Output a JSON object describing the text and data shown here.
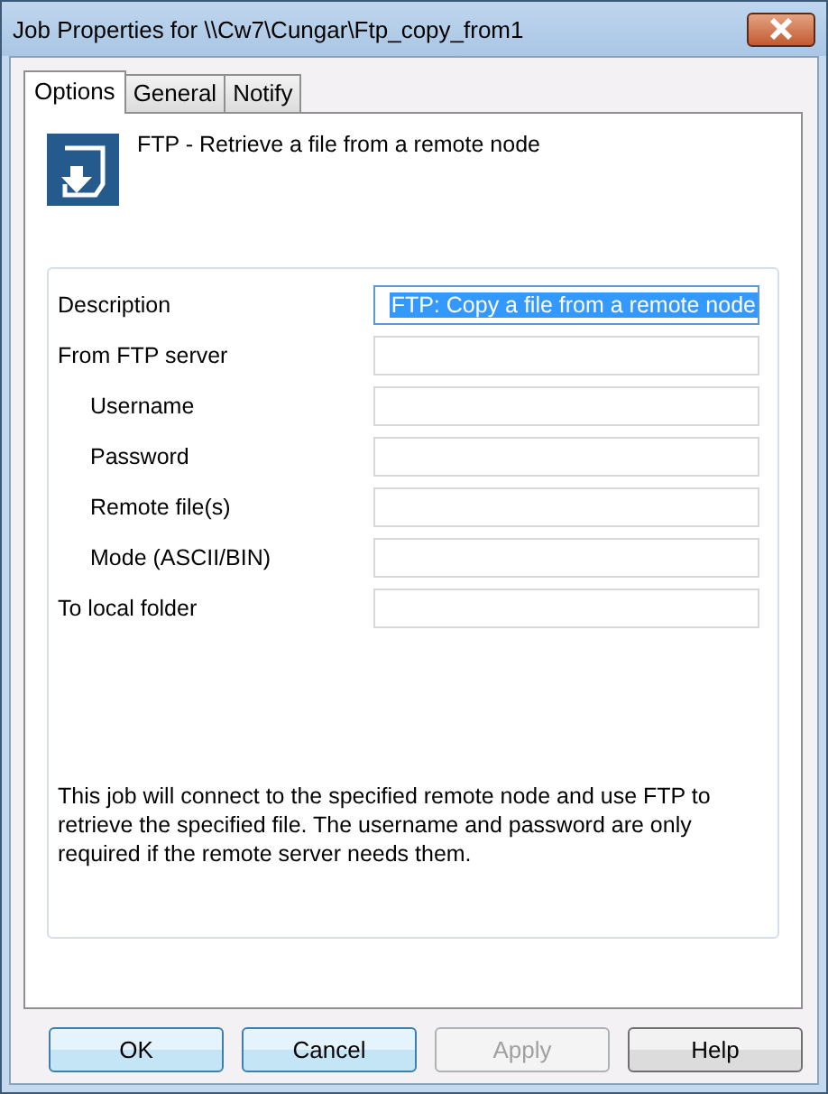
{
  "window": {
    "title": "Job Properties for \\\\Cw7\\Cungar\\Ftp_copy_from1"
  },
  "tabs": [
    {
      "label": "Options",
      "selected": true
    },
    {
      "label": "General",
      "selected": false
    },
    {
      "label": "Notify",
      "selected": false
    }
  ],
  "header": "FTP - Retrieve a file from a remote node",
  "fields": [
    {
      "label": "Description",
      "value": "FTP: Copy a file from a remote node",
      "text_selected": true
    },
    {
      "label": "From FTP server",
      "children": [
        {
          "label": "Username"
        },
        {
          "label": "Password"
        },
        {
          "label": "Remote file(s)"
        },
        {
          "label": "Mode (ASCII/BIN)"
        }
      ]
    },
    {
      "label": "To local folder"
    }
  ],
  "note": "This job will connect to the specified remote node and use FTP to retrieve the specified file.  The username and password are only required if the remote server needs them.",
  "buttons": [
    {
      "label": "OK",
      "disabled": false
    },
    {
      "label": "Cancel",
      "disabled": false
    },
    {
      "label": "Apply",
      "disabled": true
    },
    {
      "label": "Help",
      "disabled": false
    }
  ]
}
